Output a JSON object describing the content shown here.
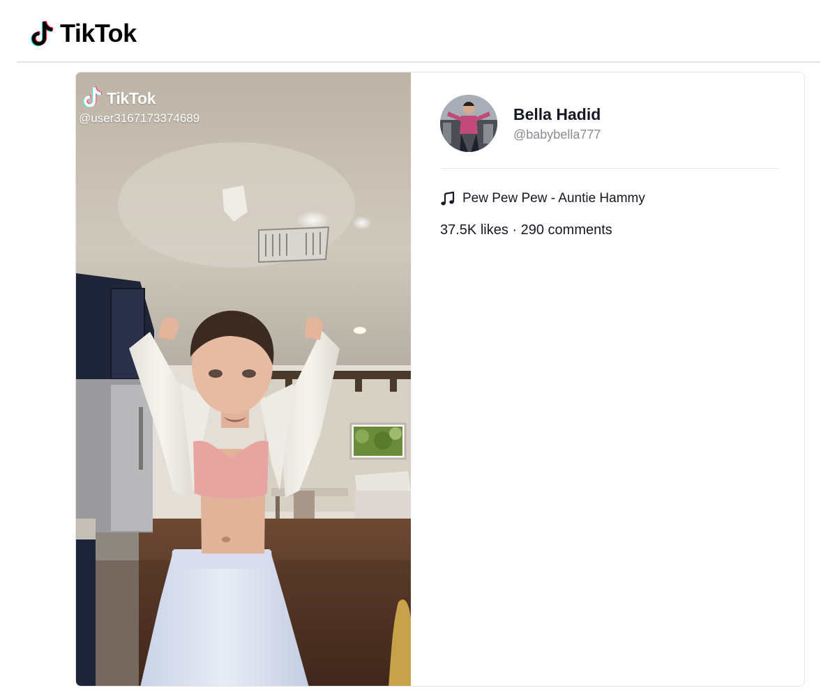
{
  "header": {
    "brand": "TikTok",
    "logo_icon": "tiktok-note-icon"
  },
  "video": {
    "watermark_brand": "TikTok",
    "watermark_user": "@user3167173374689"
  },
  "author": {
    "name": "Bella Hadid",
    "handle": "@babybella777"
  },
  "music": {
    "icon": "music-note-icon",
    "title": "Pew Pew Pew - Auntie Hammy"
  },
  "stats": {
    "likes": "37.5K likes",
    "separator": " · ",
    "comments": "290 comments"
  },
  "colors": {
    "tiktok_cyan": "#25F4EE",
    "tiktok_red": "#FE2C55",
    "text_primary": "#161823",
    "text_secondary": "#8A8B91"
  }
}
